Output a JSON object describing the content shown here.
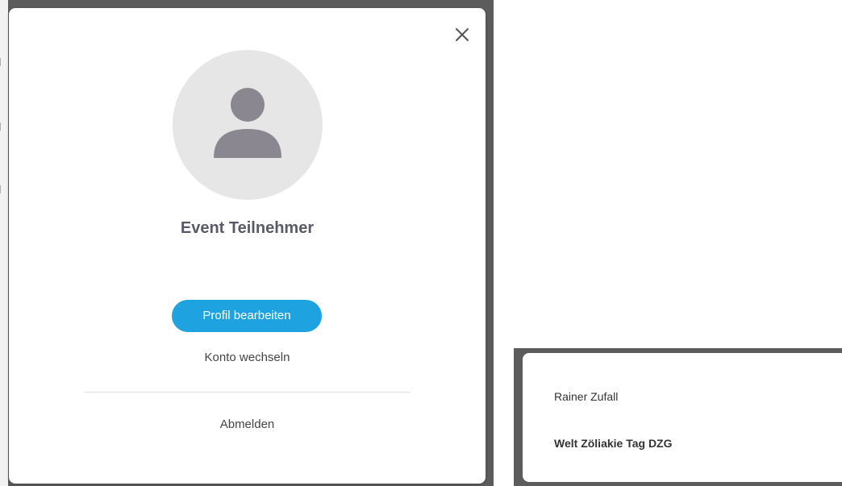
{
  "profile_modal": {
    "display_name": "Event Teilnehmer",
    "edit_profile_label": "Profil bearbeiten",
    "switch_account_label": "Konto wechseln",
    "logout_label": "Abmelden",
    "close_icon": "close-icon",
    "avatar_icon": "user-placeholder-icon"
  },
  "account_dropdown": {
    "items": [
      {
        "label": "Rainer Zufall"
      },
      {
        "label": "Welt Zöliakie Tag DZG"
      }
    ]
  },
  "colors": {
    "accent": "#1ea3e0",
    "overlay": "#5c5c5c",
    "avatar_bg": "#e6e6e6",
    "avatar_icon": "#8a8791",
    "name_text": "#5a5a66"
  }
}
